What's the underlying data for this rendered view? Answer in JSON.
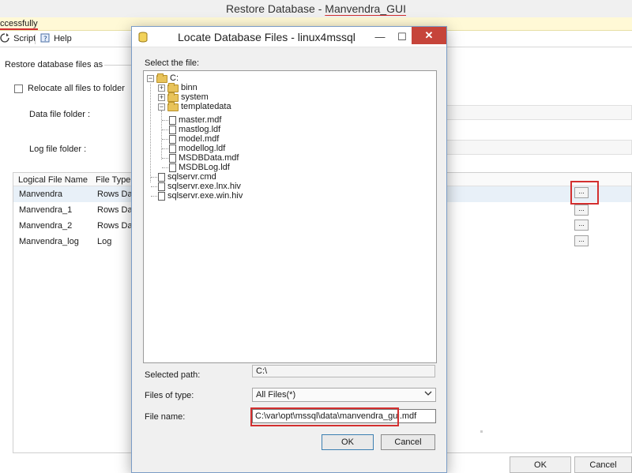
{
  "background": {
    "window_title_prefix": "Restore Database - ",
    "window_title_db": "Manvendra_GUI",
    "status_text": "ccessfully",
    "toolbar": {
      "script_label": "Script",
      "help_label": "Help"
    },
    "section_label": "Restore database files as",
    "relocate_label": "Relocate all files to folder",
    "data_folder_label": "Data file folder :",
    "log_folder_label": "Log file folder :",
    "grid": {
      "headers": [
        "Logical File Name",
        "File Type"
      ],
      "rows": [
        {
          "name": "Manvendra",
          "type": "Rows Da"
        },
        {
          "name": "Manvendra_1",
          "type": "Rows Da"
        },
        {
          "name": "Manvendra_2",
          "type": "Rows Da"
        },
        {
          "name": "Manvendra_log",
          "type": "Log"
        }
      ],
      "browse_label": "..."
    },
    "ok_label": "OK",
    "cancel_label": "Cancel"
  },
  "dialog": {
    "title": "Locate Database Files - linux4mssql",
    "select_label": "Select the file:",
    "tree": {
      "root": "C:",
      "binn": "binn",
      "system": "system",
      "templatedata": "templatedata",
      "template_files": [
        "master.mdf",
        "mastlog.ldf",
        "model.mdf",
        "modellog.ldf",
        "MSDBData.mdf",
        "MSDBLog.ldf"
      ],
      "root_files": [
        "sqlservr.cmd",
        "sqlservr.exe.lnx.hiv",
        "sqlservr.exe.win.hiv"
      ]
    },
    "selected_path_label": "Selected path:",
    "selected_path_value": "C:\\",
    "files_of_type_label": "Files of type:",
    "files_of_type_value": "All Files(*)",
    "file_name_label": "File name:",
    "file_name_value": "C:\\var\\opt\\mssql\\data\\manvendra_gui.mdf",
    "ok_label": "OK",
    "cancel_label": "Cancel",
    "minimize_glyph": "—",
    "maximize_glyph": "☐",
    "close_glyph": "✕"
  },
  "colors": {
    "highlight": "#d32f2f",
    "close_button": "#c6443a",
    "status_bar": "#fff9d6"
  }
}
